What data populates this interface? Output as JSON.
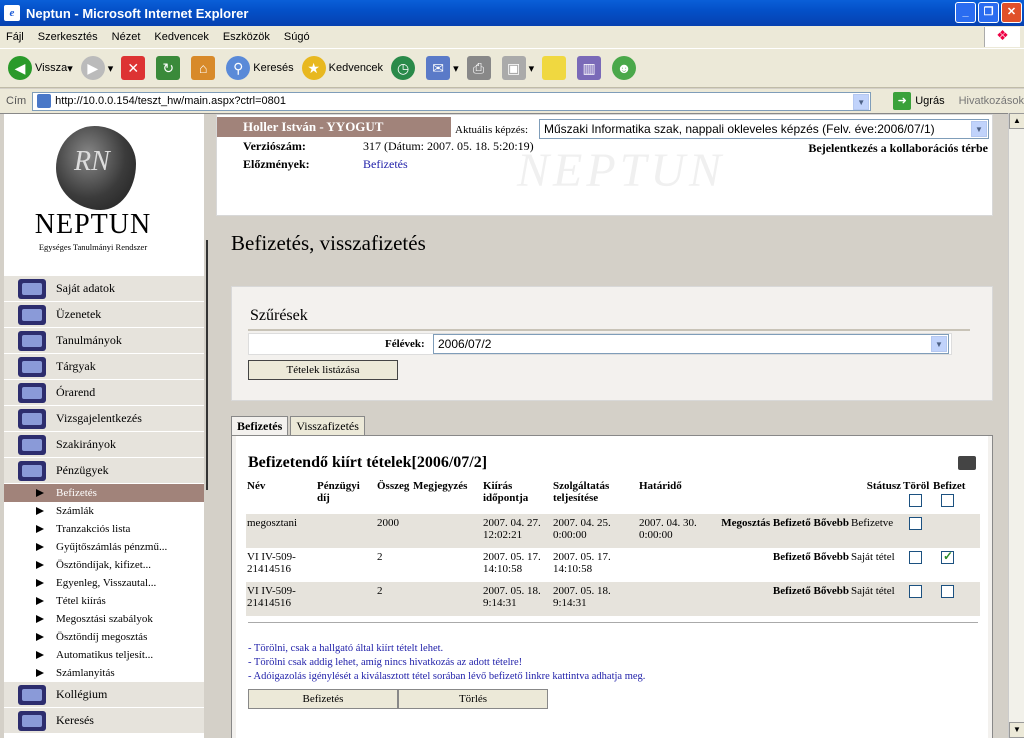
{
  "window": {
    "title": "Neptun - Microsoft Internet Explorer"
  },
  "menu": [
    "Fájl",
    "Szerkesztés",
    "Nézet",
    "Kedvencek",
    "Eszközök",
    "Súgó"
  ],
  "toolbar": {
    "back": "Vissza",
    "search": "Keresés",
    "favorites": "Kedvencek"
  },
  "address": {
    "label": "Cím",
    "url": "http://10.0.0.154/teszt_hw/main.aspx?ctrl=0801",
    "go": "Ugrás",
    "links": "Hivatkozások"
  },
  "logo": {
    "title": "NEPTUN",
    "subtitle": "Egységes Tanulmányi Rendszer",
    "watermark": "NEPTUN"
  },
  "nav": {
    "items": [
      "Saját adatok",
      "Üzenetek",
      "Tanulmányok",
      "Tárgyak",
      "Órarend",
      "Vizsgajelentkezés",
      "Szakirányok",
      "Pénzügyek"
    ],
    "sub": [
      "Befizetés",
      "Számlák",
      "Tranzakciós lista",
      "Gyűjtőszámlás pénzmű...",
      "Ösztöndíjak, kifizet...",
      "Egyenleg, Visszautal...",
      "Tétel kiírás",
      "Megosztási szabályok",
      "Ösztöndíj megosztás",
      "Automatikus teljesít...",
      "Számlanyitás"
    ],
    "after": [
      "Kollégium",
      "Keresés"
    ]
  },
  "header": {
    "user": "Holler István - YYOGUT",
    "kepzes_label": "Aktuális képzés:",
    "kepzes_value": "Műszaki Informatika szak, nappali okleveles képzés (Felv. éve:2006/07/1)",
    "version_label": "Verziószám:",
    "version_value": "317 (Dátum: 2007. 05. 18. 5:20:19)",
    "history_label": "Előzmények:",
    "history_value": "Befizetés",
    "collab": "Bejelentkezés a kollaborációs térbe"
  },
  "page": {
    "title": "Befizetés, visszafizetés"
  },
  "filters": {
    "title": "Szűrések",
    "felevek_label": "Félévek:",
    "felevek_value": "2006/07/2",
    "list_button": "Tételek listázása"
  },
  "tabs": [
    "Befizetés",
    "Visszafizetés"
  ],
  "panel": {
    "title": "Befizetendő kiírt tételek[2006/07/2]",
    "columns": [
      "Név",
      "Pénzügyi díj",
      "Összeg",
      "Megjegyzés",
      "Kiírás időpontja",
      "Szolgáltatás teljesítése",
      "Határidő",
      "",
      "Státusz",
      "Töröl",
      "Befizet"
    ],
    "rows": [
      {
        "nev": "megosztani",
        "dij": "",
        "osszeg": "2000",
        "megj": "",
        "kiiras": "2007. 04. 27. 12:02:21",
        "teljesites": "2007. 04. 25. 0:00:00",
        "hatarido": "2007. 04. 30. 0:00:00",
        "actions": "Megosztás Befizető Bővebb",
        "statusz": "Befizetve",
        "torol": false,
        "befizet": null
      },
      {
        "nev": "VI IV-509-21414516",
        "dij": "",
        "osszeg": "2",
        "megj": "",
        "kiiras": "2007. 05. 17. 14:10:58",
        "teljesites": "2007. 05. 17. 14:10:58",
        "hatarido": "",
        "actions": "Befizető Bővebb",
        "statusz": "Saját tétel",
        "torol": false,
        "befizet": true
      },
      {
        "nev": "VI IV-509-21414516",
        "dij": "",
        "osszeg": "2",
        "megj": "",
        "kiiras": "2007. 05. 18. 9:14:31",
        "teljesites": "2007. 05. 18. 9:14:31",
        "hatarido": "",
        "actions": "Befizető Bővebb",
        "statusz": "Saját tétel",
        "torol": false,
        "befizet": false
      }
    ],
    "notes": [
      "- Törölni, csak a hallgató által kiírt tételt lehet.",
      "- Törölni csak addig lehet, amíg nincs hivatkozás az adott tételre!",
      "- Adóigazolás igénylését a kiválasztott tétel sorában lévő befizető linkre kattintva adhatja meg."
    ],
    "pay_button": "Befizetés",
    "delete_button": "Törlés"
  }
}
